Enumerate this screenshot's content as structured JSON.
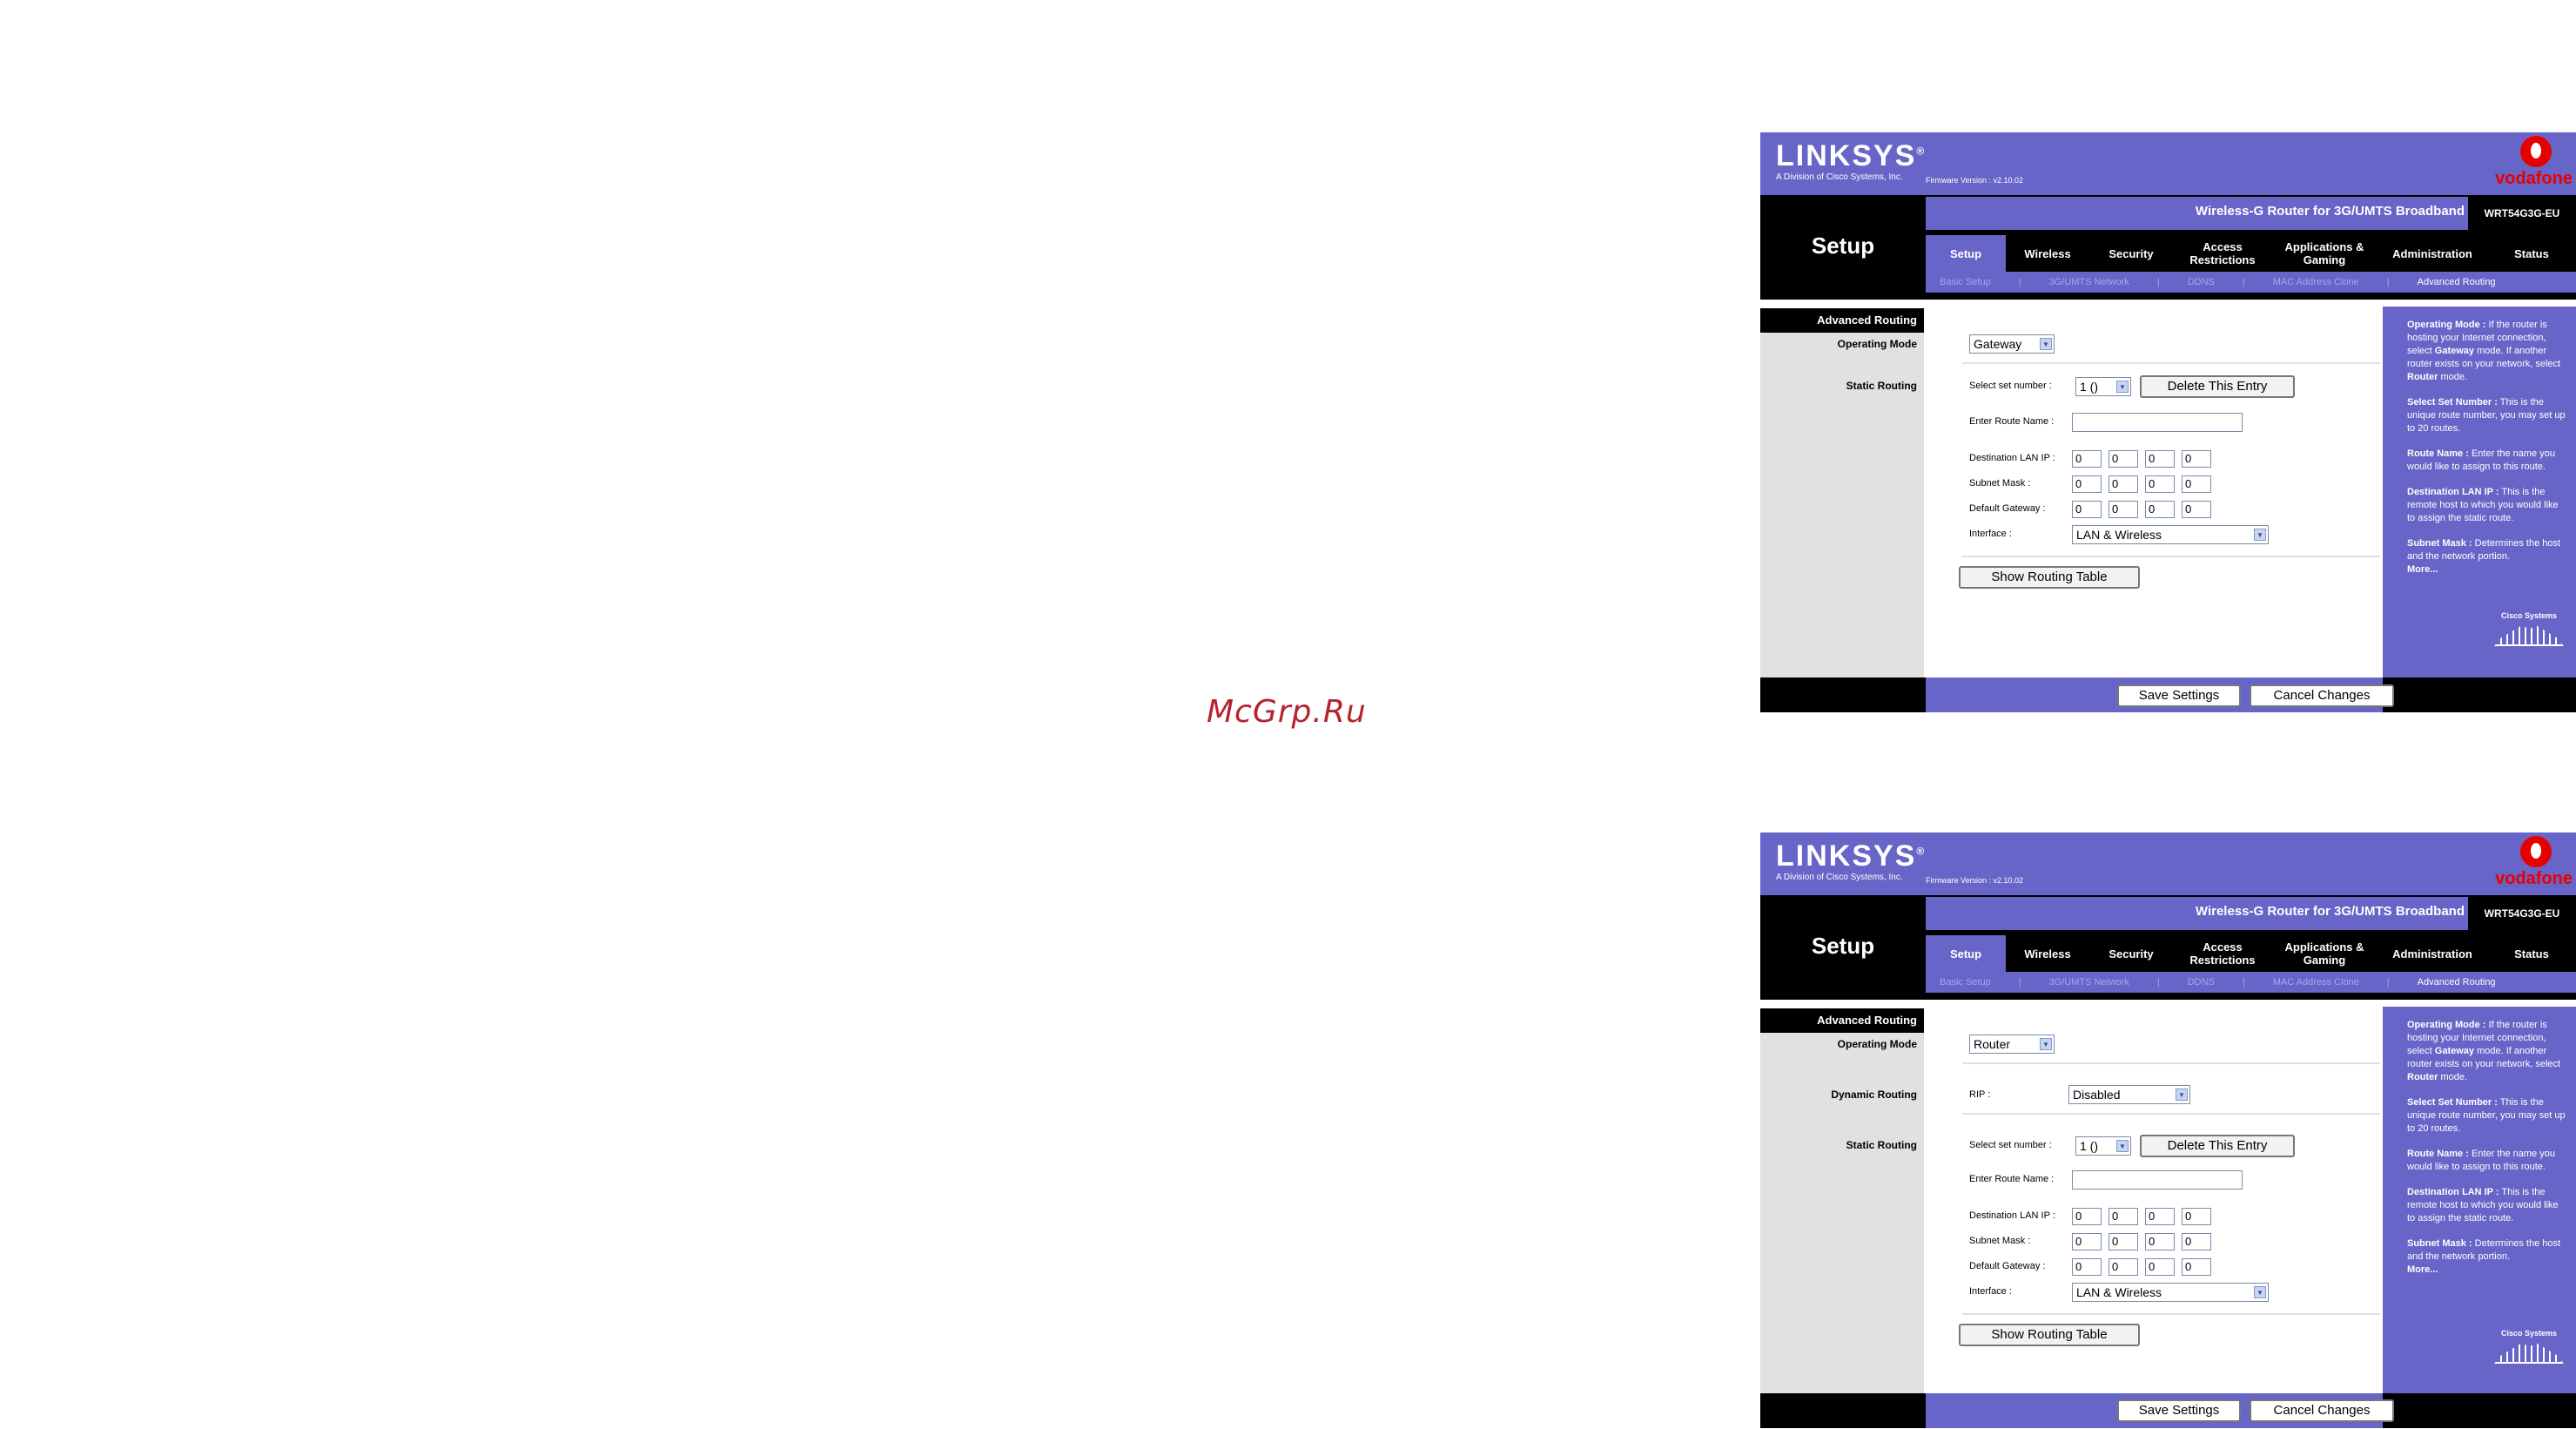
{
  "watermark": "McGrp.Ru",
  "common": {
    "brand": "LINKSYS",
    "brand_sub": "A Division of Cisco Systems, Inc.",
    "firmware": "Firmware Version : v2.10.02",
    "operator": "vodafone",
    "section": "Setup",
    "product_name": "Wireless-G Router for 3G/UMTS Broadband",
    "model": "WRT54G3G-EU",
    "tabs": [
      "Setup",
      "Wireless",
      "Security",
      "Access Restrictions",
      "Applications & Gaming",
      "Administration",
      "Status"
    ],
    "subtabs": [
      "Basic Setup",
      "|",
      "3G/UMTS Network",
      "|",
      "DDNS",
      "|",
      "MAC Address Clone",
      "|",
      "Advanced Routing"
    ],
    "page_title": "Advanced Routing",
    "labels": {
      "operating_mode": "Operating Mode",
      "dynamic_routing": "Dynamic Routing",
      "static_routing": "Static Routing",
      "rip": "RIP :",
      "select_set_number": "Select set number :",
      "enter_route_name": "Enter Route Name :",
      "destination_lan_ip": "Destination LAN IP :",
      "subnet_mask": "Subnet Mask :",
      "default_gateway": "Default Gateway :",
      "interface": "Interface :"
    },
    "buttons": {
      "delete_entry": "Delete This Entry",
      "show_routing_table": "Show Routing Table",
      "save": "Save Settings",
      "cancel": "Cancel Changes"
    },
    "set_number_value": "1 ()",
    "interface_value": "LAN & Wireless",
    "octet": "0",
    "help": [
      {
        "title": "Operating Mode :",
        "text": " If the router is hosting your Internet connection, select ",
        "b1": "Gateway",
        "t2": " mode. If another router exists on your network, select ",
        "b2": "Router",
        "t3": " mode."
      },
      {
        "title": "Select Set Number :",
        "text": " This is the unique route number, you may set up to 20 routes."
      },
      {
        "title": "Route Name :",
        "text": " Enter the name you would like to assign to this route."
      },
      {
        "title": "Destination LAN IP :",
        "text": " This is the remote host to which you would like to assign the static route."
      },
      {
        "title": "Subnet Mask :",
        "text": " Determines the host and the network portion."
      }
    ],
    "more": "More...",
    "cisco": "Cisco Systems"
  },
  "panel1": {
    "operating_mode_value": "Gateway"
  },
  "panel2": {
    "operating_mode_value": "Router",
    "rip_value": "Disabled"
  },
  "colors": {
    "accent": "#6865c8",
    "brand_red": "#e60000",
    "watermark": "#b5232f"
  }
}
